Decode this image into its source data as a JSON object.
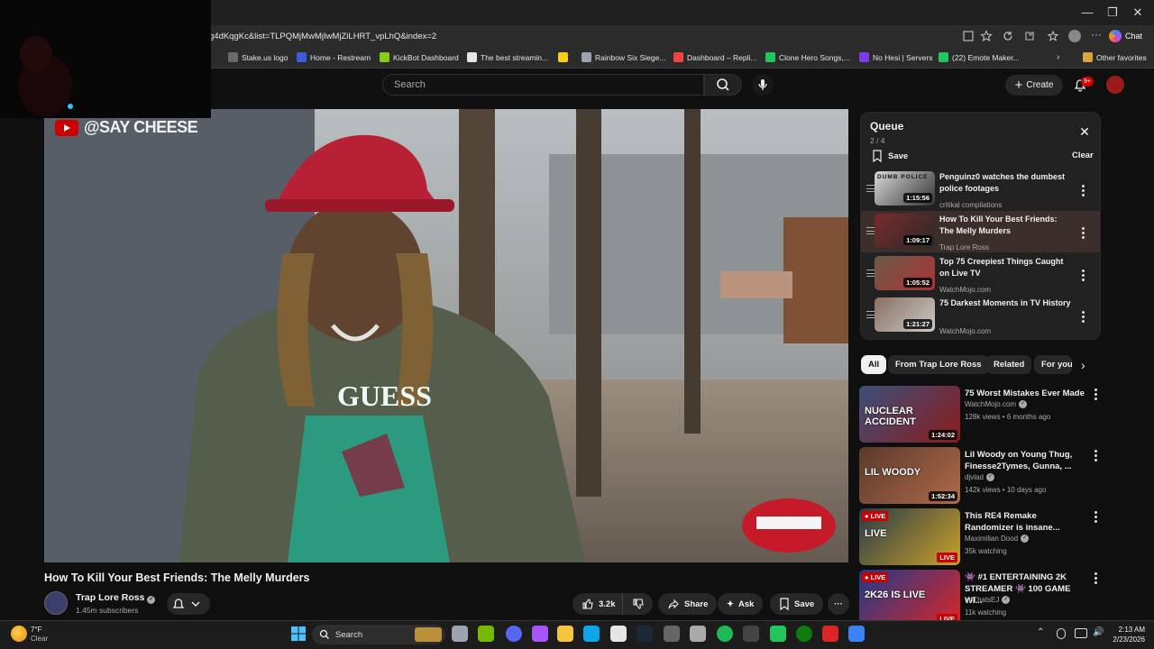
{
  "browser": {
    "url": "g4dKqgKc&list=TLPQMjMwMjIwMjZiLHRT_vpLhQ&index=2",
    "chat_label": "Chat",
    "bookmarks": [
      {
        "label": "Stake.us logo",
        "color": "#6b6b6b"
      },
      {
        "label": "Home - Restream",
        "color": "#3b5bdb"
      },
      {
        "label": "KickBot Dashboard",
        "color": "#84cc16"
      },
      {
        "label": "The best streamin...",
        "color": "#e5e5e5"
      },
      {
        "label": "",
        "color": "#facc15"
      },
      {
        "label": "Rainbow Six Siege...",
        "color": "#9ca3af"
      },
      {
        "label": "Dashboard – Repli...",
        "color": "#ef4444"
      },
      {
        "label": "Clone Hero Songs,...",
        "color": "#22c55e"
      },
      {
        "label": "No Hesi | Servers",
        "color": "#7c3aed"
      },
      {
        "label": "(22) Emote Maker...",
        "color": "#22c55e"
      }
    ],
    "other_favorites": "Other favorites"
  },
  "youtube": {
    "search_placeholder": "Search",
    "create_label": "Create",
    "notif_badge": "9+"
  },
  "video": {
    "watermark": "@SAY CHEESE",
    "title": "How To Kill Your Best Friends: The Melly Murders",
    "channel": "Trap Lore Ross",
    "subscribers": "1.45m subscribers",
    "likes": "3.2k",
    "share_label": "Share",
    "ask_label": "Ask",
    "save_label": "Save",
    "shirt_text": "GUESS"
  },
  "queue": {
    "title": "Queue",
    "count": "2 / 4",
    "save_label": "Save",
    "clear_label": "Clear",
    "items": [
      {
        "title": "Penguinz0 watches the dumbest police footages",
        "channel": "critikal compilations",
        "duration": "1:15:56",
        "thumb_text": "DUMB POLICE",
        "c1": "#d9d9d9",
        "c2": "#333"
      },
      {
        "title": "How To Kill Your Best Friends: The Melly Murders",
        "channel": "Trap Lore Ross",
        "duration": "1:09:17",
        "thumb_text": "",
        "c1": "#7a2a2a",
        "c2": "#2a2a2a"
      },
      {
        "title": "Top 75 Creepiest Things Caught on Live TV",
        "channel": "WatchMojo.com",
        "duration": "1:05:52",
        "thumb_text": "",
        "c1": "#6b5a4a",
        "c2": "#a33"
      },
      {
        "title": "75 Darkest Moments in TV History",
        "channel": "WatchMojo.com",
        "duration": "1:21:27",
        "thumb_text": "",
        "c1": "#8a7060",
        "c2": "#c9c9c9"
      }
    ]
  },
  "chips": [
    "All",
    "From Trap Lore Ross",
    "Related",
    "For you"
  ],
  "related": [
    {
      "title": "75 Worst Mistakes Ever Made",
      "channel": "WatchMojo.com",
      "meta": "128k views • 6 months ago",
      "duration": "1:24:02",
      "thumb_text": "NUCLEAR ACCIDENT",
      "live": false,
      "c1": "#3b4f7a",
      "c2": "#8b1c1c"
    },
    {
      "title": "Lil Woody on Young Thug, Finesse2Tymes, Gunna, ...",
      "channel": "djvlad",
      "meta": "142k views • 10 days ago",
      "duration": "1:52:34",
      "thumb_text": "LIL WOODY",
      "live": false,
      "c1": "#5a3a2a",
      "c2": "#b06a4a"
    },
    {
      "title": "This RE4 Remake Randomizer is insane...",
      "channel": "Maximilian Dood",
      "meta": "35k watching",
      "duration": "",
      "thumb_text": "LIVE",
      "live": true,
      "c1": "#2a3a4a",
      "c2": "#c9a227"
    },
    {
      "title": "👾 #1 ENTERTAINING 2K STREAMER 👾 100 GAME WI...",
      "channel": "YoThatsEJ",
      "meta": "11k watching",
      "duration": "",
      "thumb_text": "2K26 IS LIVE",
      "live": true,
      "c1": "#1e3a8a",
      "c2": "#dc2626"
    }
  ],
  "taskbar": {
    "weather_temp": "7°F",
    "weather_desc": "Clear",
    "search_label": "Search",
    "time": "2:13 AM",
    "date": "2/23/2026"
  }
}
